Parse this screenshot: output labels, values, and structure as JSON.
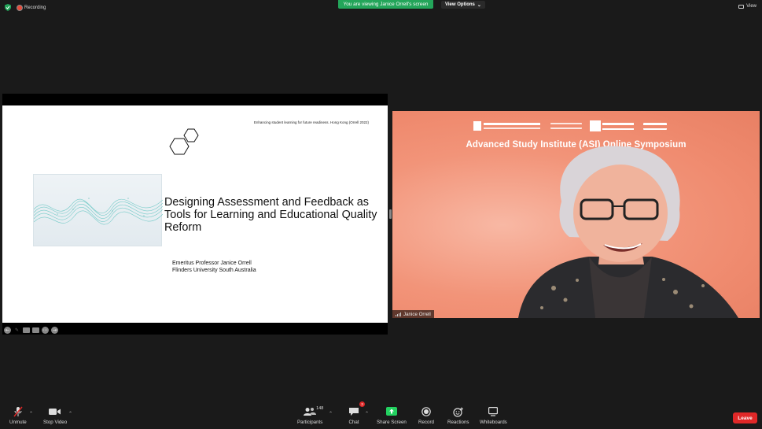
{
  "top_bar": {
    "recording_label": "Recording",
    "viewing_banner": "You are viewing Janice Orrell's screen",
    "view_options_label": "View Options",
    "view_label": "View"
  },
  "slide": {
    "header_text": "Enhancing student learning for future readiness. Hong Kong (Orrell 2022)",
    "title_lines": [
      "Designing Assessment and Feedback as",
      "Tools for Learning and Educational  Quality",
      "Reform"
    ],
    "author_lines": [
      "Emeritus Professor Janice Orrell",
      "Flinders University South Australia"
    ]
  },
  "video": {
    "banner_title": "Advanced Study Institute (ASI) Online Symposium",
    "participant_name": "Janice Orrell"
  },
  "toolbar": {
    "unmute_label": "Unmute",
    "stop_video_label": "Stop Video",
    "participants_label": "Participants",
    "participants_count": "148",
    "chat_label": "Chat",
    "chat_badge": "3",
    "share_screen_label": "Share Screen",
    "record_label": "Record",
    "reactions_label": "Reactions",
    "whiteboards_label": "Whiteboards",
    "leave_label": "Leave"
  },
  "colors": {
    "background": "#1a1a1a",
    "banner_green": "#23a55a",
    "leave_red": "#e02828",
    "share_green": "#23d160",
    "video_backdrop": "#f29479"
  }
}
